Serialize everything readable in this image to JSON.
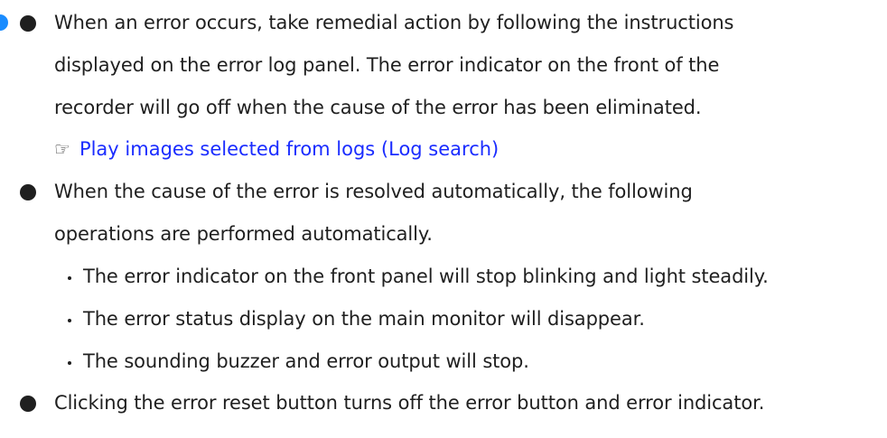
{
  "bullets": [
    {
      "lines": [
        "When an error occurs, take remedial action by following the instructions",
        "displayed on the error log panel. The error indicator on the front of the",
        "recorder will go off when the cause of the error has been eliminated."
      ],
      "link": {
        "icon": "pointing-hand-icon",
        "icon_glyph": "☞",
        "text": "Play images selected from logs (Log search)"
      }
    },
    {
      "lines": [
        "When the cause of the error is resolved automatically, the following",
        "operations are performed automatically."
      ],
      "sub_items": [
        "The error indicator on the front panel will stop blinking and light steadily.",
        "The error status display on the main monitor will disappear.",
        "The sounding buzzer and error output will stop."
      ]
    },
    {
      "lines": [
        "Clicking the error reset button turns off the error button and error indicator."
      ]
    }
  ],
  "colors": {
    "text": "#1f1f1f",
    "link": "#1a2cff",
    "edge_marker": "#1a8cff"
  }
}
